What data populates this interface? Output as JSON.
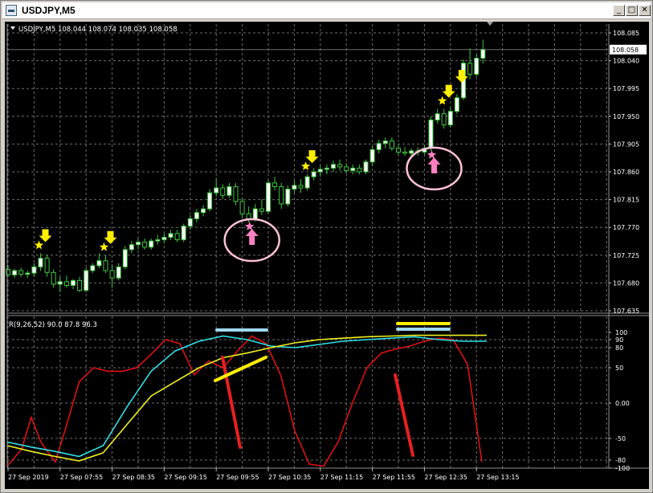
{
  "window": {
    "title": "USDJPY,M5",
    "minimize_label": "_",
    "maximize_label": "□",
    "close_label": "✕"
  },
  "chart_header": {
    "text": "USDJPY,M5  108.044 108.074 108.035 108.058"
  },
  "indicator_header": {
    "text": "R(9,26,52) 90.0 87.8 96.3"
  },
  "colors": {
    "background": "#000000",
    "grid": "#6e6e6e",
    "candle": "#3cc83c",
    "candle_body": "#ffffff",
    "price_line": "#6e6e6e",
    "arrow_yellow": "#ffee00",
    "star_yellow": "#ffee00",
    "arrow_pink": "#ff80c0",
    "circle_pink": "#ffc0d8",
    "line_red": "#e01010",
    "line_cyan": "#30e0e8",
    "line_yellow": "#f0f020",
    "bar_lightblue": "#a0d8f0",
    "bar_yellow": "#ffee00",
    "drawn_red": "#e82020",
    "drawn_yellow": "#ffee00"
  },
  "chart_data": [
    {
      "type": "candlestick",
      "symbol": "USDJPY",
      "timeframe": "M5",
      "current_price": 108.058,
      "current_price_label": "108.058",
      "ylim": [
        107.635,
        108.085
      ],
      "y_ticks": [
        "108.085",
        "108.040",
        "107.995",
        "107.950",
        "107.905",
        "107.860",
        "107.815",
        "107.770",
        "107.725",
        "107.680",
        "107.635"
      ],
      "x_ticks": [
        "27 Sep 2019",
        "27 Sep 07:55",
        "27 Sep 08:35",
        "27 Sep 09:15",
        "27 Sep 09:55",
        "27 Sep 10:35",
        "27 Sep 11:15",
        "27 Sep 11:55",
        "27 Sep 12:35",
        "27 Sep 13:15"
      ],
      "candles": [
        [
          107.702,
          107.708,
          107.69,
          107.693
        ],
        [
          107.693,
          107.703,
          107.688,
          107.7
        ],
        [
          107.7,
          107.705,
          107.69,
          107.694
        ],
        [
          107.694,
          107.7,
          107.688,
          107.696
        ],
        [
          107.696,
          107.712,
          107.69,
          107.706
        ],
        [
          107.706,
          107.728,
          107.7,
          107.72
        ],
        [
          107.72,
          107.726,
          107.69,
          107.697
        ],
        [
          107.697,
          107.702,
          107.672,
          107.678
        ],
        [
          107.678,
          107.69,
          107.665,
          107.682
        ],
        [
          107.682,
          107.692,
          107.672,
          107.676
        ],
        [
          107.676,
          107.686,
          107.67,
          107.684
        ],
        [
          107.684,
          107.69,
          107.665,
          107.668
        ],
        [
          107.668,
          107.705,
          107.665,
          107.7
        ],
        [
          107.7,
          107.712,
          107.696,
          107.708
        ],
        [
          107.708,
          107.728,
          107.704,
          107.716
        ],
        [
          107.716,
          107.725,
          107.696,
          107.7
        ],
        [
          107.7,
          107.71,
          107.672,
          107.688
        ],
        [
          107.688,
          107.712,
          107.684,
          107.706
        ],
        [
          107.706,
          107.74,
          107.702,
          107.734
        ],
        [
          107.734,
          107.748,
          107.728,
          107.742
        ],
        [
          107.742,
          107.752,
          107.734,
          107.746
        ],
        [
          107.746,
          107.752,
          107.734,
          107.738
        ],
        [
          107.738,
          107.752,
          107.734,
          107.748
        ],
        [
          107.748,
          107.758,
          107.742,
          107.75
        ],
        [
          107.75,
          107.76,
          107.744,
          107.754
        ],
        [
          107.754,
          107.766,
          107.75,
          107.76
        ],
        [
          107.76,
          107.766,
          107.746,
          107.75
        ],
        [
          107.75,
          107.776,
          107.746,
          107.772
        ],
        [
          107.772,
          107.79,
          107.766,
          107.784
        ],
        [
          107.784,
          107.8,
          107.778,
          107.794
        ],
        [
          107.794,
          107.806,
          107.788,
          107.8
        ],
        [
          107.8,
          107.832,
          107.796,
          107.826
        ],
        [
          107.826,
          107.85,
          107.82,
          107.834
        ],
        [
          107.834,
          107.84,
          107.816,
          107.822
        ],
        [
          107.822,
          107.842,
          107.818,
          107.836
        ],
        [
          107.836,
          107.842,
          107.806,
          107.812
        ],
        [
          107.812,
          107.818,
          107.786,
          107.792
        ],
        [
          107.792,
          107.804,
          107.778,
          107.784
        ],
        [
          107.784,
          107.808,
          107.78,
          107.8
        ],
        [
          107.8,
          107.816,
          107.79,
          107.796
        ],
        [
          107.796,
          107.846,
          107.792,
          107.842
        ],
        [
          107.842,
          107.852,
          107.83,
          107.836
        ],
        [
          107.836,
          107.842,
          107.8,
          107.808
        ],
        [
          107.808,
          107.838,
          107.804,
          107.832
        ],
        [
          107.832,
          107.846,
          107.826,
          107.838
        ],
        [
          107.838,
          107.848,
          107.826,
          107.834
        ],
        [
          107.834,
          107.856,
          107.83,
          107.852
        ],
        [
          107.852,
          107.866,
          107.846,
          107.86
        ],
        [
          107.86,
          107.87,
          107.852,
          107.864
        ],
        [
          107.864,
          107.872,
          107.856,
          107.866
        ],
        [
          107.866,
          107.878,
          107.86,
          107.872
        ],
        [
          107.872,
          107.88,
          107.862,
          107.868
        ],
        [
          107.868,
          107.874,
          107.858,
          107.862
        ],
        [
          107.862,
          107.872,
          107.856,
          107.866
        ],
        [
          107.866,
          107.872,
          107.856,
          107.86
        ],
        [
          107.86,
          107.88,
          107.856,
          107.876
        ],
        [
          107.876,
          107.902,
          107.87,
          107.896
        ],
        [
          107.896,
          107.912,
          107.89,
          107.906
        ],
        [
          107.906,
          107.916,
          107.898,
          107.91
        ],
        [
          107.91,
          107.916,
          107.894,
          107.898
        ],
        [
          107.898,
          107.904,
          107.888,
          107.892
        ],
        [
          107.892,
          107.9,
          107.886,
          107.89
        ],
        [
          107.89,
          107.898,
          107.884,
          107.894
        ],
        [
          107.894,
          107.9,
          107.886,
          107.892
        ],
        [
          107.892,
          107.904,
          107.888,
          107.898
        ],
        [
          107.898,
          107.95,
          107.894,
          107.944
        ],
        [
          107.944,
          107.962,
          107.938,
          107.954
        ],
        [
          107.954,
          107.962,
          107.93,
          107.936
        ],
        [
          107.936,
          107.964,
          107.932,
          107.958
        ],
        [
          107.958,
          107.986,
          107.954,
          107.98
        ],
        [
          107.98,
          108.042,
          107.976,
          108.036
        ],
        [
          108.036,
          108.06,
          108.01,
          108.018
        ],
        [
          108.018,
          108.05,
          108.014,
          108.044
        ],
        [
          108.044,
          108.074,
          108.035,
          108.058
        ]
      ],
      "signals_down": [
        5,
        15,
        46,
        67,
        69
      ],
      "signals_down_star": [
        5,
        15,
        46,
        67
      ],
      "signals_up": [
        37,
        65
      ],
      "signals_up_star": [
        37,
        65
      ]
    },
    {
      "type": "line",
      "name": "R(9,26,52)",
      "values_label": "90.0 87.8 96.3",
      "ylim": [
        -100,
        100
      ],
      "y_ticks": [
        "100",
        "90",
        "80",
        "50",
        "0.00",
        "-50",
        "-80",
        "-100"
      ],
      "series": [
        {
          "key": "r9",
          "color": "#e01010",
          "x": [
            0,
            3,
            5,
            7,
            10,
            12,
            15,
            18,
            21,
            24,
            27,
            30,
            33,
            36,
            39,
            42,
            45,
            48,
            51,
            54,
            57,
            60,
            63,
            66,
            69,
            72,
            75,
            78,
            81,
            84,
            87,
            90,
            93,
            96,
            99
          ],
          "values": [
            -95,
            -65,
            -20,
            -55,
            -85,
            -40,
            30,
            50,
            45,
            45,
            50,
            70,
            90,
            85,
            40,
            60,
            50,
            75,
            95,
            85,
            40,
            -40,
            -90,
            -95,
            -55,
            0,
            50,
            72,
            78,
            82,
            88,
            92,
            90,
            55,
            -85
          ]
        },
        {
          "key": "r26",
          "color": "#30e0e8",
          "x": [
            0,
            5,
            10,
            15,
            20,
            25,
            30,
            35,
            40,
            45,
            50,
            55,
            60,
            65,
            70,
            75,
            80,
            85,
            90,
            95,
            100
          ],
          "values": [
            -55,
            -62,
            -68,
            -75,
            -60,
            -5,
            45,
            75,
            88,
            95,
            90,
            82,
            80,
            84,
            88,
            90,
            92,
            94,
            90,
            88,
            88
          ]
        },
        {
          "key": "r52",
          "color": "#f0f020",
          "x": [
            0,
            5,
            10,
            15,
            20,
            25,
            30,
            35,
            40,
            45,
            50,
            55,
            60,
            65,
            70,
            75,
            80,
            85,
            90,
            95,
            100
          ],
          "values": [
            -60,
            -68,
            -75,
            -82,
            -70,
            -30,
            10,
            30,
            50,
            65,
            72,
            80,
            86,
            90,
            92,
            94,
            95,
            96,
            96,
            96,
            96
          ]
        }
      ]
    }
  ]
}
